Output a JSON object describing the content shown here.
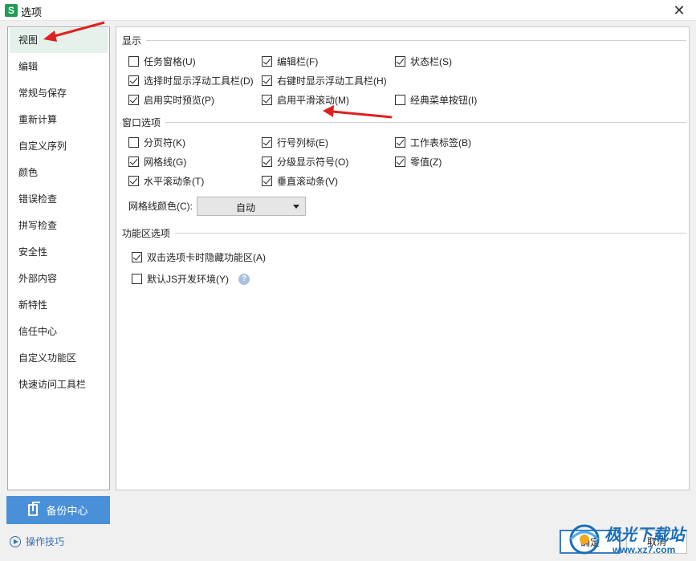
{
  "window": {
    "title": "选项",
    "app_icon_letter": "S",
    "close_symbol": "✕"
  },
  "sidebar": {
    "items": [
      {
        "label": "视图",
        "active": true
      },
      {
        "label": "编辑"
      },
      {
        "label": "常规与保存"
      },
      {
        "label": "重新计算"
      },
      {
        "label": "自定义序列"
      },
      {
        "label": "颜色"
      },
      {
        "label": "错误检查"
      },
      {
        "label": "拼写检查"
      },
      {
        "label": "安全性"
      },
      {
        "label": "外部内容"
      },
      {
        "label": "新特性"
      },
      {
        "label": "信任中心"
      },
      {
        "label": "自定义功能区"
      },
      {
        "label": "快速访问工具栏"
      }
    ],
    "backup_label": "备份中心",
    "tips_label": "操作技巧"
  },
  "sections": {
    "display": {
      "title": "显示",
      "options": [
        {
          "label": "任务窗格(U)",
          "checked": false
        },
        {
          "label": "编辑栏(F)",
          "checked": true
        },
        {
          "label": "状态栏(S)",
          "checked": true
        },
        {
          "label": "选择时显示浮动工具栏(D)",
          "checked": true
        },
        {
          "label": "右键时显示浮动工具栏(H)",
          "checked": true
        },
        {
          "label": "启用实时预览(P)",
          "checked": true
        },
        {
          "label": "启用平滑滚动(M)",
          "checked": true
        },
        {
          "label": "经典菜单按钮(I)",
          "checked": false
        }
      ]
    },
    "window_options": {
      "title": "窗口选项",
      "options": [
        {
          "label": "分页符(K)",
          "checked": false
        },
        {
          "label": "行号列标(E)",
          "checked": true
        },
        {
          "label": "工作表标签(B)",
          "checked": true
        },
        {
          "label": "网格线(G)",
          "checked": true
        },
        {
          "label": "分级显示符号(O)",
          "checked": true
        },
        {
          "label": "零值(Z)",
          "checked": true
        },
        {
          "label": "水平滚动条(T)",
          "checked": true
        },
        {
          "label": "垂直滚动条(V)",
          "checked": true
        }
      ],
      "grid_color_label": "网格线颜色(C):",
      "grid_color_value": "自动"
    },
    "ribbon": {
      "title": "功能区选项",
      "options": [
        {
          "label": "双击选项卡时隐藏功能区(A)",
          "checked": true
        },
        {
          "label": "默认JS开发环境(Y)",
          "checked": false
        }
      ],
      "help_symbol": "?"
    }
  },
  "buttons": {
    "ok": "确定",
    "cancel": "取消"
  },
  "watermark": {
    "text": "极光下载站",
    "sub": "www.xz7.com"
  },
  "colors": {
    "accent": "#4a90d9",
    "active_item": "#e5f1ea",
    "annotation_arrow": "#e02020",
    "app_icon": "#1f9d55"
  }
}
